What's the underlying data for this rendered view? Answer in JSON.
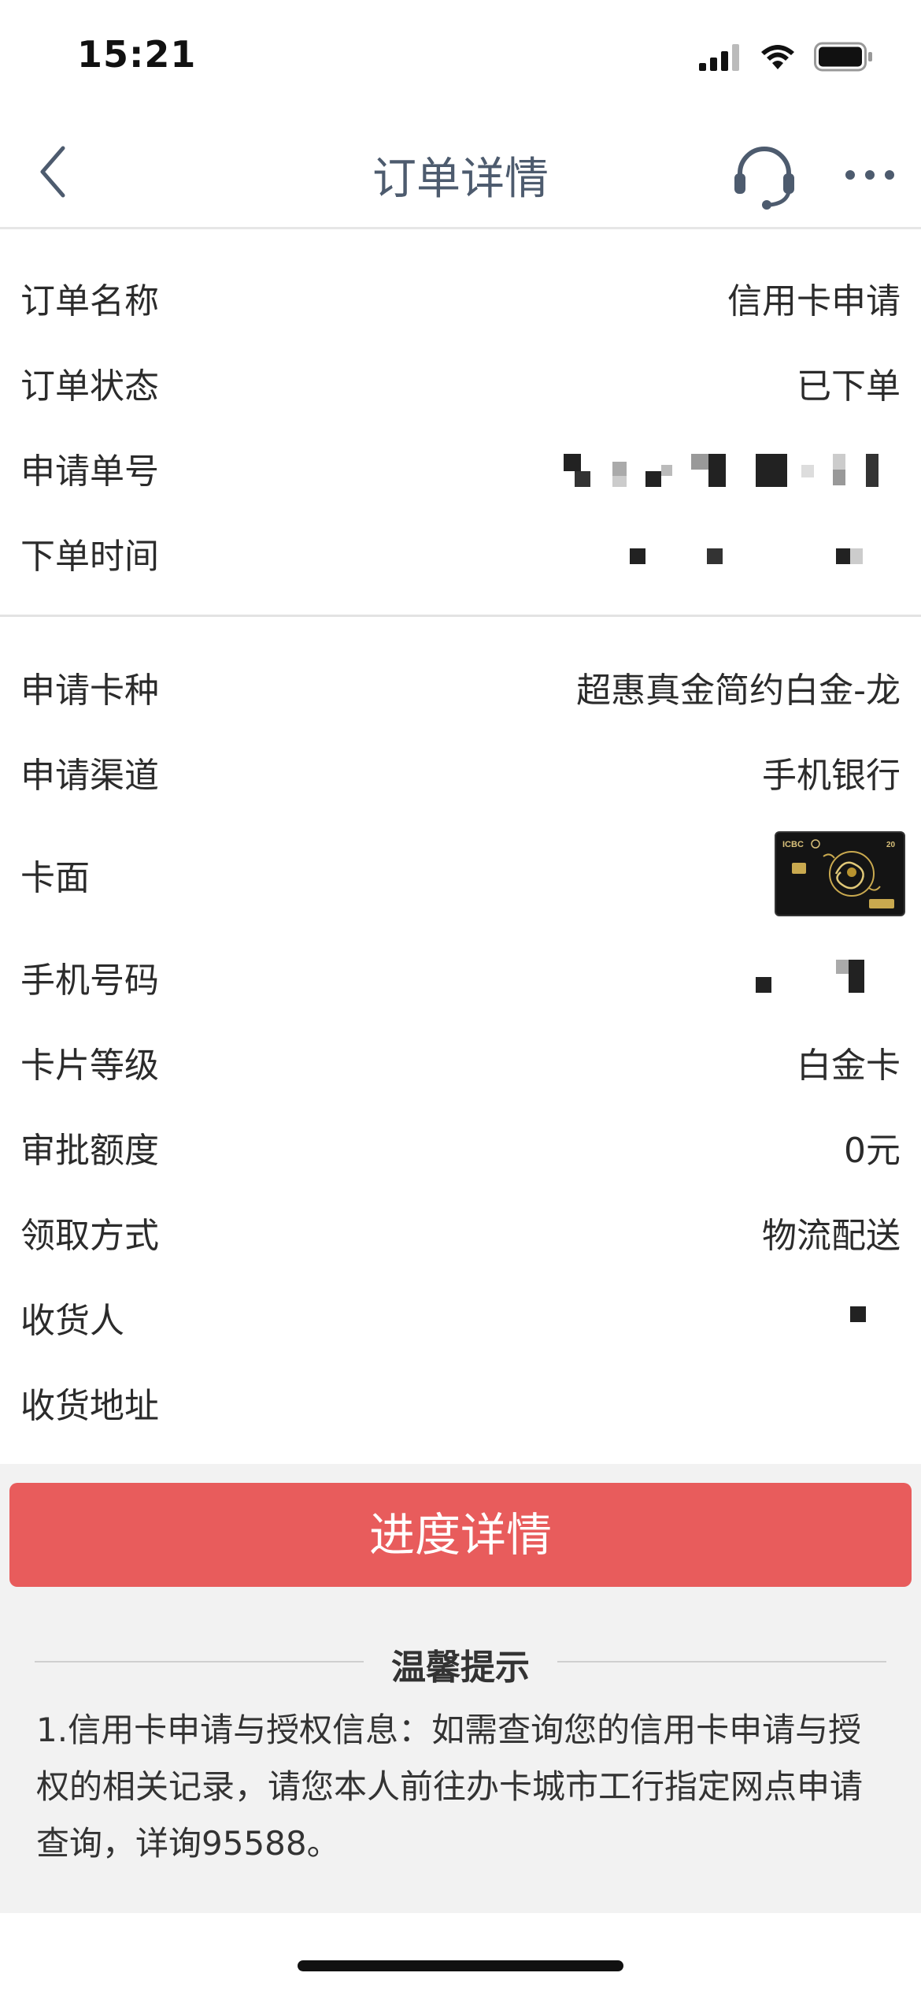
{
  "status_bar": {
    "time": "15:21"
  },
  "nav": {
    "title": "订单详情"
  },
  "order": {
    "name_label": "订单名称",
    "name_value": "信用卡申请",
    "status_label": "订单状态",
    "status_value": "已下单",
    "number_label": "申请单号",
    "time_label": "下单时间"
  },
  "card": {
    "type_label": "申请卡种",
    "type_value": "超惠真金简约白金-龙",
    "channel_label": "申请渠道",
    "channel_value": "手机银行",
    "face_label": "卡面",
    "phone_label": "手机号码",
    "level_label": "卡片等级",
    "level_value": "白金卡",
    "limit_label": "审批额度",
    "limit_value": "0元",
    "pickup_label": "领取方式",
    "pickup_value": "物流配送",
    "receiver_label": "收货人",
    "address_label": "收货地址",
    "card_brand": "ICBC"
  },
  "progress_button": "进度详情",
  "tips": {
    "title": "温馨提示",
    "text": "1.信用卡申请与授权信息：如需查询您的信用卡申请与授权的相关记录，请您本人前往办卡城市工行指定网点申请查询，详询95588。"
  },
  "icons": [
    "back-icon",
    "customer-service-icon",
    "more-icon",
    "signal-icon",
    "wifi-icon",
    "battery-icon"
  ],
  "colors": {
    "accent": "#e85c5c",
    "title": "#4d5b6e",
    "grey_bg": "#f2f2f2"
  }
}
